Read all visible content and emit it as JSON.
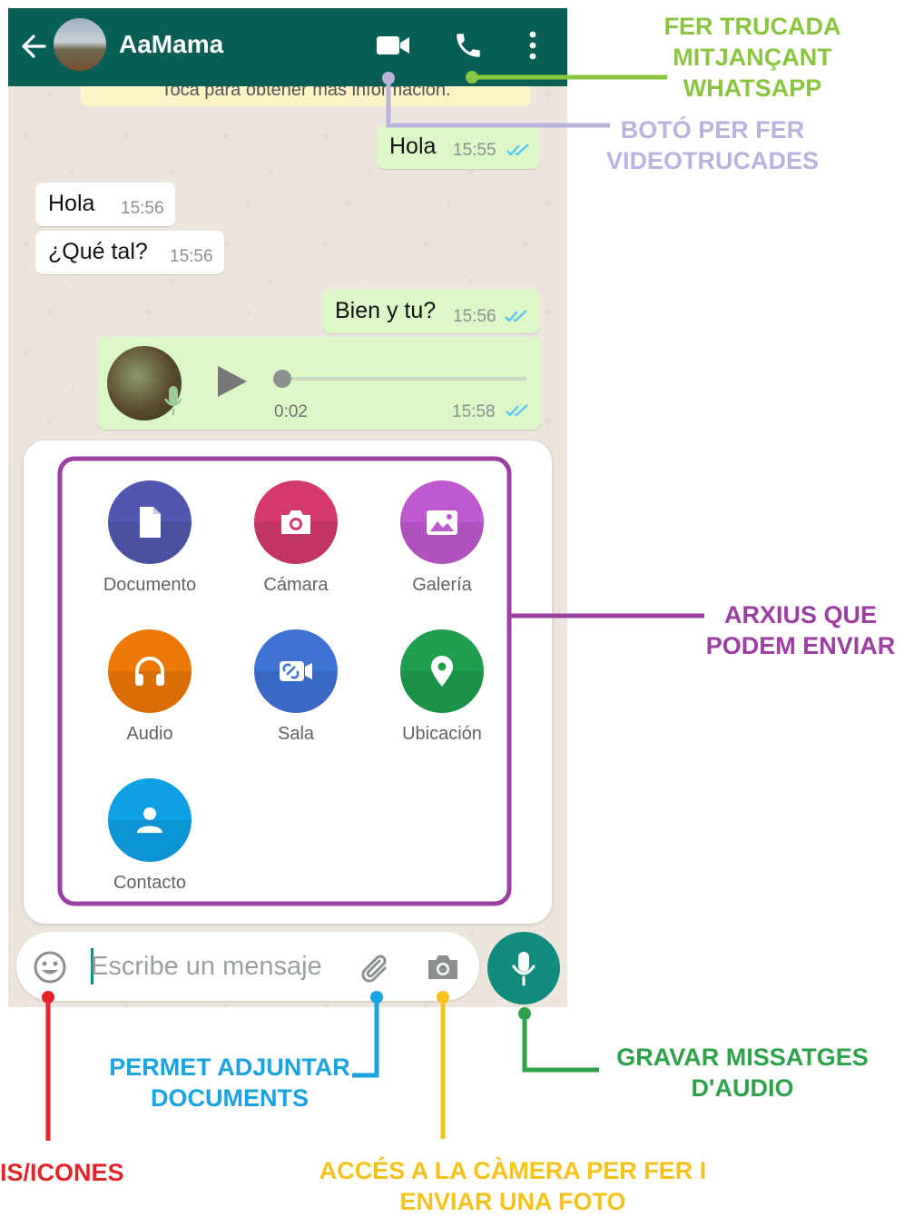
{
  "chat": {
    "contact_name": "AaMama",
    "banner_text": "Toca para obtener más información.",
    "messages": [
      {
        "dir": "out",
        "text": "Hola",
        "time": "15:55"
      },
      {
        "dir": "in",
        "text": "Hola",
        "time": "15:56"
      },
      {
        "dir": "in",
        "text": "¿Qué tal?",
        "time": "15:56"
      },
      {
        "dir": "out",
        "text": "Bien y tu?",
        "time": "15:56"
      }
    ],
    "audio": {
      "duration": "0:02",
      "time": "15:58"
    }
  },
  "attachments": [
    {
      "label": "Documento",
      "icon": "document-icon",
      "color": "#5157ae"
    },
    {
      "label": "Cámara",
      "icon": "camera-icon",
      "color": "#d3396d"
    },
    {
      "label": "Galería",
      "icon": "gallery-icon",
      "color": "#bf59cf"
    },
    {
      "label": "Audio",
      "icon": "headphones-icon",
      "color": "#ec7905"
    },
    {
      "label": "Sala",
      "icon": "room-icon",
      "color": "#3e72d5"
    },
    {
      "label": "Ubicación",
      "icon": "location-icon",
      "color": "#1f9e4f"
    },
    {
      "label": "Contacto",
      "icon": "contact-icon",
      "color": "#0ea0e5"
    }
  ],
  "input": {
    "placeholder": "Escribe un mensaje"
  },
  "annotations": {
    "call": "FER TRUCADA MITJANÇANT WHATSAPP",
    "video": "BOTÓ PER FER VIDEOTRUCADES",
    "files": "ARXIUS QUE PODEM ENVIAR",
    "attach": "PERMET ADJUNTAR DOCUMENTS",
    "audio": "GRAVAR MISSATGES D'AUDIO",
    "emoji": "IS/ICONES",
    "camera": "ACCÉS A LA CÀMERA PER FER I ENVIAR UNA FOTO"
  },
  "colors": {
    "header": "#075e54",
    "outgoing": "#dcf8c6",
    "call_annotation": "#8bc53f",
    "video_annotation": "#b9b3dd",
    "files_annotation": "#9b3fa0",
    "attach_annotation": "#1aa3e0",
    "audio_annotation": "#2ea24a",
    "emoji_annotation": "#e3242b",
    "camera_annotation": "#f4c21a"
  }
}
